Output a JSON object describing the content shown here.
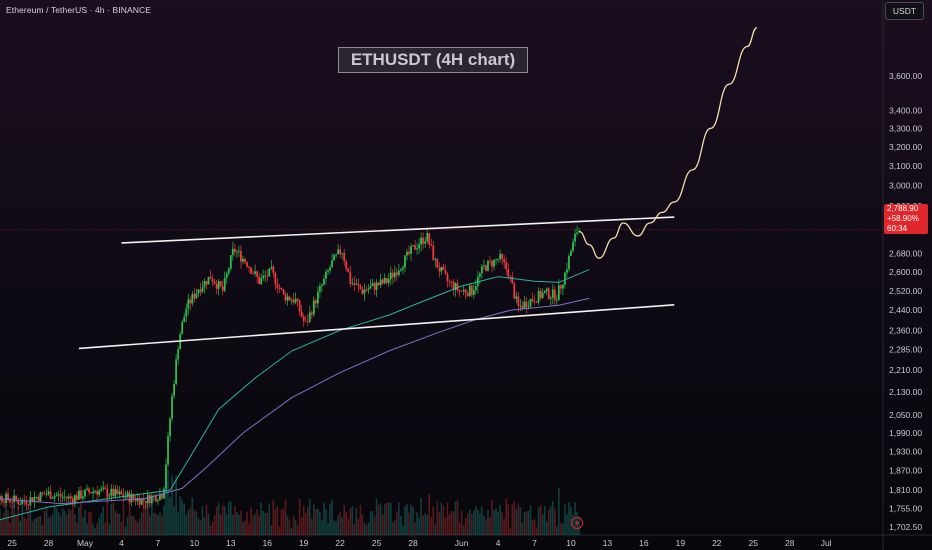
{
  "header": {
    "symbol_title": "Ethereum / TetherUS · 4h · BINANCE",
    "currency": "USDT"
  },
  "annotation": {
    "label": "ETHUSDT (4H chart)"
  },
  "price_tag": {
    "price": "2,788.90",
    "change": "+58.90%",
    "countdown": "60:34"
  },
  "colors": {
    "up": "#26a69a",
    "up_bright": "#2ebd4e",
    "down": "#ef3b3b",
    "line_white": "#f2f2f2",
    "ma_teal": "#2bb39b",
    "ma_purple": "#7e6fc9",
    "projection": "#f3deaa",
    "price_tag": "#e0272b"
  },
  "chart_data": {
    "type": "candlestick",
    "symbol": "ETHUSDT",
    "interval": "4h",
    "y_axis": {
      "scale": "log",
      "ylim": [
        1680,
        3950
      ],
      "ticks": [
        1702.5,
        1755,
        1810,
        1870,
        1930,
        1990,
        2050,
        2130,
        2210,
        2285,
        2360,
        2440,
        2520,
        2600,
        2680,
        2900,
        3000,
        3100,
        3200,
        3300,
        3400,
        3600
      ],
      "tick_labels": [
        "1,702.50",
        "1,755.00",
        "1,810.00",
        "1,870.00",
        "1,930.00",
        "1,990.00",
        "2,050.00",
        "2,130.00",
        "2,210.00",
        "2,285.00",
        "2,360.00",
        "2,440.00",
        "2,520.00",
        "2,600.00",
        "2,680.00",
        "2,900.00",
        "3,000.00",
        "3,100.00",
        "3,200.00",
        "3,300.00",
        "3,400.00",
        "3,600.00"
      ]
    },
    "x_axis": {
      "ticks": [
        {
          "label": "25",
          "day": -6
        },
        {
          "label": "28",
          "day": -3
        },
        {
          "label": "May",
          "day": 0
        },
        {
          "label": "4",
          "day": 3
        },
        {
          "label": "7",
          "day": 6
        },
        {
          "label": "10",
          "day": 9
        },
        {
          "label": "13",
          "day": 12
        },
        {
          "label": "16",
          "day": 15
        },
        {
          "label": "19",
          "day": 18
        },
        {
          "label": "22",
          "day": 21
        },
        {
          "label": "25",
          "day": 24
        },
        {
          "label": "28",
          "day": 27
        },
        {
          "label": "Jun",
          "day": 31
        },
        {
          "label": "4",
          "day": 34
        },
        {
          "label": "7",
          "day": 37
        },
        {
          "label": "10",
          "day": 40
        },
        {
          "label": "13",
          "day": 43
        },
        {
          "label": "16",
          "day": 46
        },
        {
          "label": "19",
          "day": 49
        },
        {
          "label": "22",
          "day": 52
        },
        {
          "label": "25",
          "day": 55
        },
        {
          "label": "28",
          "day": 58
        },
        {
          "label": "Jul",
          "day": 61
        }
      ]
    },
    "price_path": [
      [
        -9,
        1760
      ],
      [
        -7,
        1790
      ],
      [
        -5,
        1775
      ],
      [
        -3,
        1800
      ],
      [
        -1,
        1785
      ],
      [
        1,
        1810
      ],
      [
        3,
        1795
      ],
      [
        5,
        1780
      ],
      [
        6.6,
        1800
      ],
      [
        7.3,
        2100
      ],
      [
        7.9,
        2330
      ],
      [
        8.5,
        2450
      ],
      [
        9.5,
        2530
      ],
      [
        10.5,
        2580
      ],
      [
        11.5,
        2520
      ],
      [
        12.4,
        2700
      ],
      [
        13.5,
        2640
      ],
      [
        14.5,
        2560
      ],
      [
        15.5,
        2600
      ],
      [
        16.5,
        2500
      ],
      [
        17.5,
        2480
      ],
      [
        18.3,
        2380
      ],
      [
        19.3,
        2500
      ],
      [
        20.5,
        2640
      ],
      [
        21.3,
        2700
      ],
      [
        22,
        2560
      ],
      [
        23,
        2520
      ],
      [
        24,
        2540
      ],
      [
        25,
        2560
      ],
      [
        26,
        2620
      ],
      [
        27.3,
        2710
      ],
      [
        28.3,
        2760
      ],
      [
        29,
        2640
      ],
      [
        30,
        2560
      ],
      [
        31,
        2520
      ],
      [
        32,
        2520
      ],
      [
        33,
        2620
      ],
      [
        34.3,
        2660
      ],
      [
        35,
        2600
      ],
      [
        35.8,
        2450
      ],
      [
        36.8,
        2480
      ],
      [
        38,
        2510
      ],
      [
        39,
        2500
      ],
      [
        39.6,
        2580
      ],
      [
        40.2,
        2700
      ],
      [
        40.7,
        2788.9
      ]
    ],
    "channel_lines": [
      {
        "name": "",
        "from": [
          3,
          2728
        ],
        "to": [
          48.5,
          2848
        ]
      },
      {
        "name": "",
        "from": [
          -0.5,
          2290
        ],
        "to": [
          48.5,
          2462
        ]
      }
    ],
    "moving_averages": [
      {
        "name": "",
        "color": "#2bb39b",
        "points": [
          [
            -9,
            1705
          ],
          [
            -3,
            1760
          ],
          [
            3,
            1790
          ],
          [
            7,
            1810
          ],
          [
            9,
            1935
          ],
          [
            11,
            2070
          ],
          [
            14,
            2180
          ],
          [
            17,
            2280
          ],
          [
            21,
            2360
          ],
          [
            25,
            2420
          ],
          [
            28,
            2480
          ],
          [
            31,
            2540
          ],
          [
            34,
            2580
          ],
          [
            37,
            2560
          ],
          [
            39,
            2555
          ],
          [
            41.5,
            2610
          ]
        ]
      },
      {
        "name": "",
        "color": "#7e6fc9",
        "points": [
          [
            -9,
            1790
          ],
          [
            -2,
            1770
          ],
          [
            5,
            1785
          ],
          [
            8,
            1815
          ],
          [
            10,
            1880
          ],
          [
            13,
            1990
          ],
          [
            17,
            2110
          ],
          [
            21,
            2200
          ],
          [
            25,
            2280
          ],
          [
            29,
            2350
          ],
          [
            32,
            2400
          ],
          [
            35,
            2440
          ],
          [
            39,
            2460
          ],
          [
            41.5,
            2488
          ]
        ]
      }
    ],
    "projection_path": [
      [
        40.7,
        2780
      ],
      [
        41.5,
        2720
      ],
      [
        42.3,
        2660
      ],
      [
        43.5,
        2750
      ],
      [
        44.3,
        2820
      ],
      [
        45.5,
        2760
      ],
      [
        46.5,
        2820
      ],
      [
        47.5,
        2870
      ],
      [
        48.5,
        2920
      ],
      [
        50,
        3080
      ],
      [
        51.5,
        3300
      ],
      [
        53,
        3550
      ],
      [
        54.5,
        3780
      ],
      [
        55.3,
        3900
      ]
    ],
    "current_price": 2788.9
  }
}
